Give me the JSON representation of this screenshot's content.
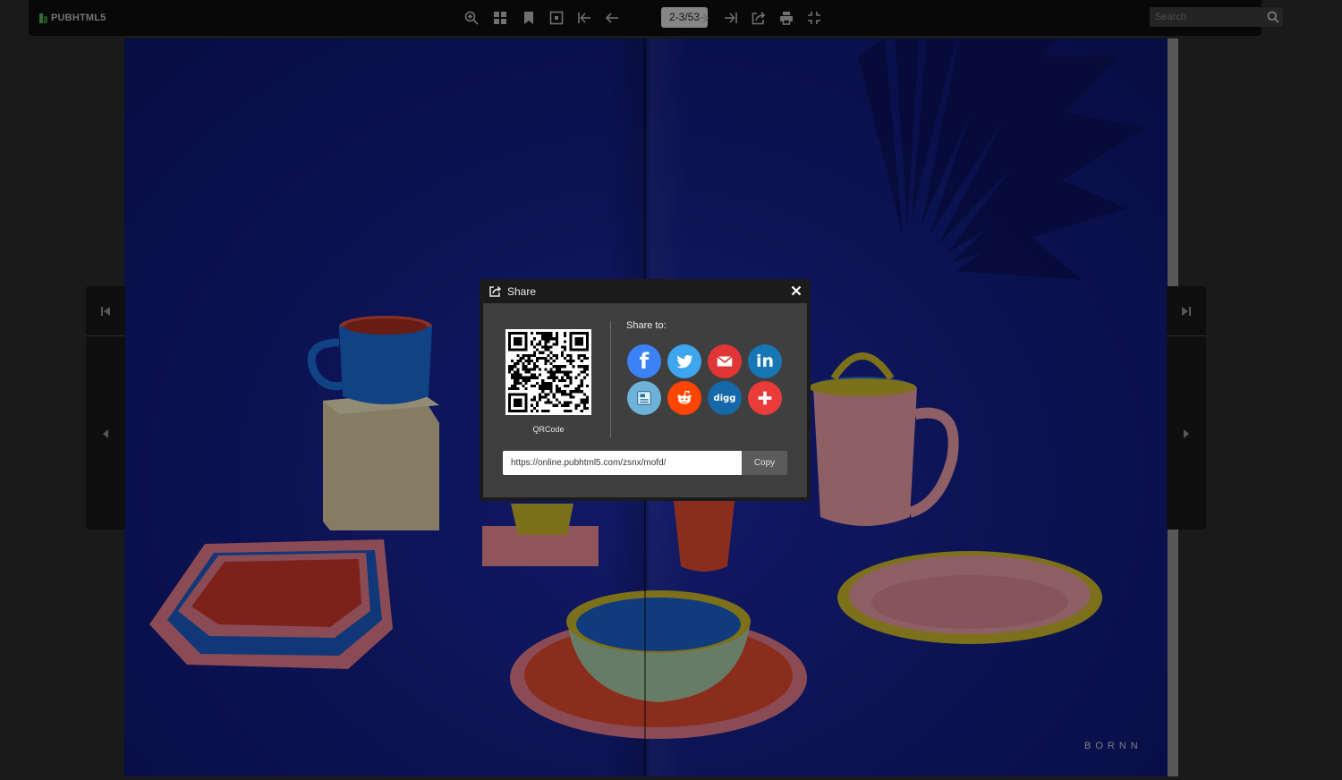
{
  "toolbar": {
    "logo_text": "PUBHTML5",
    "page_indicator": "2-3/53",
    "search_placeholder": "Search",
    "buttons": [
      "zoom-in-icon",
      "thumbnails-icon",
      "bookmark-icon",
      "single-page-icon",
      "first-page-icon",
      "previous-page-icon",
      "next-page-icon",
      "last-page-icon",
      "share-icon",
      "print-icon",
      "fullscreen-icon"
    ]
  },
  "book": {
    "brand_mark": "BORNN"
  },
  "share_dialog": {
    "title": "Share",
    "qr_label": "QRCode",
    "share_to_label": "Share to:",
    "url": "https://online.pubhtml5.com/zsnx/mofd/",
    "copy_label": "Copy",
    "networks": [
      {
        "name": "facebook",
        "color": "#3b82f6",
        "glyph": "f"
      },
      {
        "name": "twitter",
        "color": "#3ea6ee"
      },
      {
        "name": "email",
        "color": "#e13636"
      },
      {
        "name": "linkedin",
        "color": "#1777b5",
        "glyph": "in"
      },
      {
        "name": "blogger",
        "color": "#6fb2d9"
      },
      {
        "name": "reddit",
        "color": "#ff4500"
      },
      {
        "name": "digg",
        "color": "#1569a8",
        "glyph": "digg"
      },
      {
        "name": "more",
        "color": "#ea3b3b"
      }
    ]
  }
}
